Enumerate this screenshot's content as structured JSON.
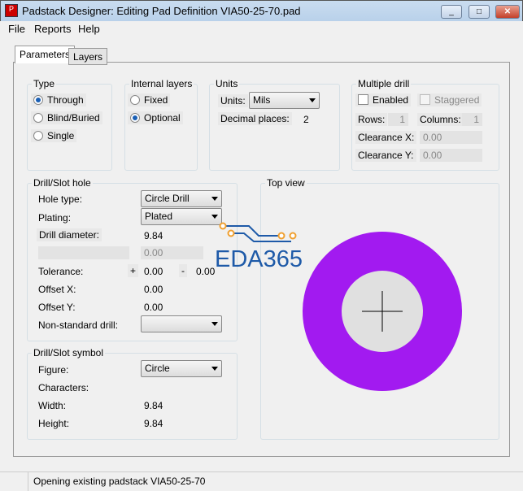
{
  "window": {
    "title": "Padstack Designer: Editing Pad Definition VIA50-25-70.pad",
    "min": "_",
    "max": "□",
    "close": "✕"
  },
  "menu": [
    "File",
    "Reports",
    "Help"
  ],
  "tabs": [
    "Parameters",
    "Layers"
  ],
  "type": {
    "legend": "Type",
    "options": [
      "Through",
      "Blind/Buried",
      "Single"
    ],
    "selected": 0
  },
  "internal": {
    "legend": "Internal layers",
    "options": [
      "Fixed",
      "Optional"
    ],
    "selected": 1
  },
  "units": {
    "legend": "Units",
    "units_label": "Units:",
    "units_value": "Mils",
    "decimal_label": "Decimal places:",
    "decimal_value": "2"
  },
  "multi": {
    "legend": "Multiple drill",
    "enabled": "Enabled",
    "staggered": "Staggered",
    "rows_label": "Rows:",
    "rows": "1",
    "cols_label": "Columns:",
    "cols": "1",
    "clrx_label": "Clearance X:",
    "clrx": "0.00",
    "clry_label": "Clearance Y:",
    "clry": "0.00"
  },
  "drill": {
    "legend": "Drill/Slot hole",
    "hole_type_label": "Hole type:",
    "hole_type": "Circle Drill",
    "plating_label": "Plating:",
    "plating": "Plated",
    "diameter_label": "Drill diameter:",
    "diameter": "9.84",
    "second": "0.00",
    "tolerance_label": "Tolerance:",
    "plus": "+",
    "tol_plus": "0.00",
    "minus": "-",
    "tol_minus": "0.00",
    "offx_label": "Offset X:",
    "offx": "0.00",
    "offy_label": "Offset Y:",
    "offy": "0.00",
    "nonstd_label": "Non-standard drill:",
    "nonstd": ""
  },
  "symbol": {
    "legend": "Drill/Slot symbol",
    "figure_label": "Figure:",
    "figure": "Circle",
    "chars_label": "Characters:",
    "width_label": "Width:",
    "width": "9.84",
    "height_label": "Height:",
    "height": "9.84"
  },
  "topview": {
    "legend": "Top view",
    "pad_color": "#a21af0",
    "hole_color": "#e0e0e0"
  },
  "watermark": "EDA365",
  "status": "Opening existing padstack VIA50-25-70"
}
